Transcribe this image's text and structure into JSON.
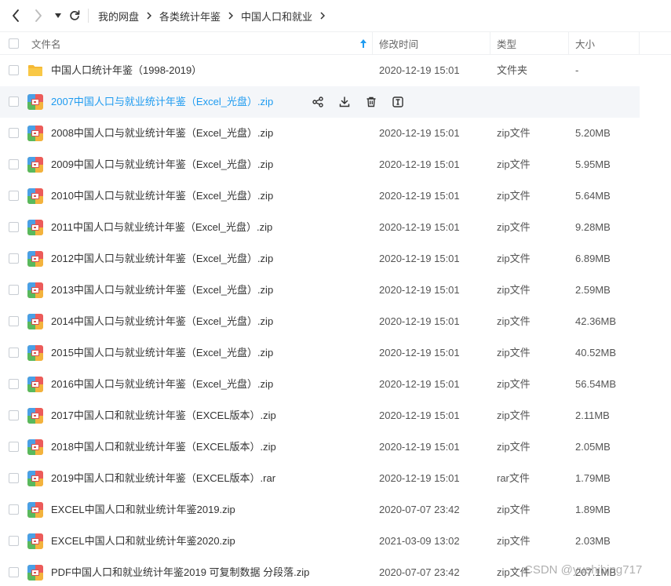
{
  "breadcrumb": [
    "我的网盘",
    "各类统计年鉴",
    "中国人口和就业"
  ],
  "header": {
    "name": "文件名",
    "modified": "修改时间",
    "type": "类型",
    "size": "大小"
  },
  "rows": [
    {
      "name": "中国人口统计年鉴（1998-2019）",
      "date": "2020-12-19 15:01",
      "type": "文件夹",
      "size": "-",
      "icon": "folder-icon"
    },
    {
      "name": "2007中国人口与就业统计年鉴（Excel_光盘）.zip",
      "date": "",
      "type": "",
      "size": "",
      "icon": "zip-icon",
      "hover": true
    },
    {
      "name": "2008中国人口与就业统计年鉴（Excel_光盘）.zip",
      "date": "2020-12-19 15:01",
      "type": "zip文件",
      "size": "5.20MB",
      "icon": "zip-icon"
    },
    {
      "name": "2009中国人口与就业统计年鉴（Excel_光盘）.zip",
      "date": "2020-12-19 15:01",
      "type": "zip文件",
      "size": "5.95MB",
      "icon": "zip-icon"
    },
    {
      "name": "2010中国人口与就业统计年鉴（Excel_光盘）.zip",
      "date": "2020-12-19 15:01",
      "type": "zip文件",
      "size": "5.64MB",
      "icon": "zip-icon"
    },
    {
      "name": "2011中国人口与就业统计年鉴（Excel_光盘）.zip",
      "date": "2020-12-19 15:01",
      "type": "zip文件",
      "size": "9.28MB",
      "icon": "zip-icon"
    },
    {
      "name": "2012中国人口与就业统计年鉴（Excel_光盘）.zip",
      "date": "2020-12-19 15:01",
      "type": "zip文件",
      "size": "6.89MB",
      "icon": "zip-icon"
    },
    {
      "name": "2013中国人口与就业统计年鉴（Excel_光盘）.zip",
      "date": "2020-12-19 15:01",
      "type": "zip文件",
      "size": "2.59MB",
      "icon": "zip-icon"
    },
    {
      "name": "2014中国人口与就业统计年鉴（Excel_光盘）.zip",
      "date": "2020-12-19 15:01",
      "type": "zip文件",
      "size": "42.36MB",
      "icon": "zip-icon"
    },
    {
      "name": "2015中国人口与就业统计年鉴（Excel_光盘）.zip",
      "date": "2020-12-19 15:01",
      "type": "zip文件",
      "size": "40.52MB",
      "icon": "zip-icon"
    },
    {
      "name": "2016中国人口与就业统计年鉴（Excel_光盘）.zip",
      "date": "2020-12-19 15:01",
      "type": "zip文件",
      "size": "56.54MB",
      "icon": "zip-icon"
    },
    {
      "name": "2017中国人口和就业统计年鉴（EXCEL版本）.zip",
      "date": "2020-12-19 15:01",
      "type": "zip文件",
      "size": "2.11MB",
      "icon": "zip-icon"
    },
    {
      "name": "2018中国人口和就业统计年鉴（EXCEL版本）.zip",
      "date": "2020-12-19 15:01",
      "type": "zip文件",
      "size": "2.05MB",
      "icon": "zip-icon"
    },
    {
      "name": "2019中国人口和就业统计年鉴（EXCEL版本）.rar",
      "date": "2020-12-19 15:01",
      "type": "rar文件",
      "size": "1.79MB",
      "icon": "zip-icon"
    },
    {
      "name": "EXCEL中国人口和就业统计年鉴2019.zip",
      "date": "2020-07-07 23:42",
      "type": "zip文件",
      "size": "1.89MB",
      "icon": "zip-icon"
    },
    {
      "name": "EXCEL中国人口和就业统计年鉴2020.zip",
      "date": "2021-03-09 13:02",
      "type": "zip文件",
      "size": "2.03MB",
      "icon": "zip-icon"
    },
    {
      "name": "PDF中国人口和就业统计年鉴2019 可复制数据 分段落.zip",
      "date": "2020-07-07 23:42",
      "type": "zip文件",
      "size": "207.1MB",
      "icon": "zip-icon"
    }
  ],
  "watermark": "CSDN @yushibing717",
  "colors": {
    "accent": "#1e9bf0",
    "folder": "#f7c244",
    "hover_bg": "#f4f6f9"
  }
}
